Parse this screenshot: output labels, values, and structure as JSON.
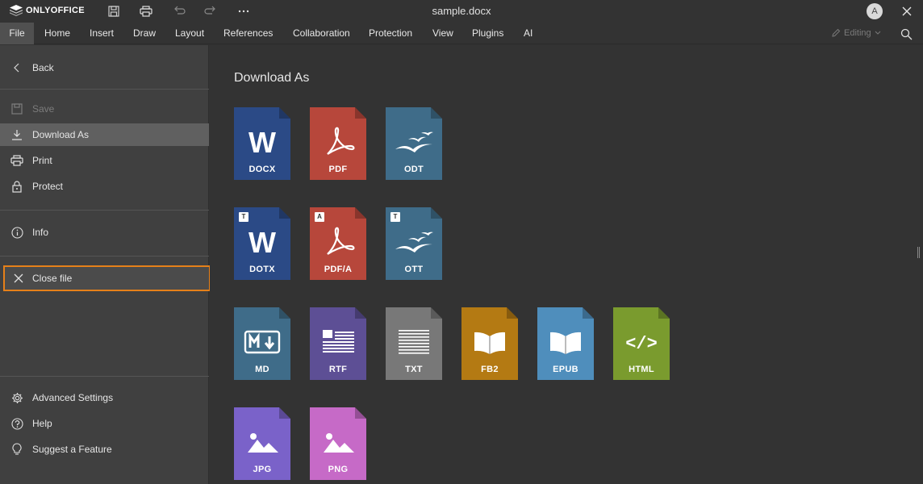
{
  "app": {
    "brand": "ONLYOFFICE",
    "doc_title": "sample.docx",
    "avatar_initial": "A",
    "editing_label": "Editing"
  },
  "menu": {
    "tabs": [
      "File",
      "Home",
      "Insert",
      "Draw",
      "Layout",
      "References",
      "Collaboration",
      "Protection",
      "View",
      "Plugins",
      "AI"
    ],
    "active_tab": "File"
  },
  "file_panel": {
    "back": "Back",
    "save": "Save",
    "download_as": "Download As",
    "print": "Print",
    "protect": "Protect",
    "info": "Info",
    "close_file": "Close file",
    "advanced_settings": "Advanced Settings",
    "help": "Help",
    "suggest_feature": "Suggest a Feature"
  },
  "download": {
    "heading": "Download As",
    "formats": [
      {
        "ext": "DOCX",
        "color": "#2b4a86",
        "glyph": "W",
        "badge": ""
      },
      {
        "ext": "PDF",
        "color": "#b7473b",
        "glyph": "pdf",
        "badge": ""
      },
      {
        "ext": "ODT",
        "color": "#3f6c89",
        "glyph": "gulls",
        "badge": ""
      },
      {
        "ext": "DOTX",
        "color": "#2b4a86",
        "glyph": "W",
        "badge": "T"
      },
      {
        "ext": "PDF/A",
        "color": "#b7473b",
        "glyph": "pdf",
        "badge": "A"
      },
      {
        "ext": "OTT",
        "color": "#3f6c89",
        "glyph": "gulls",
        "badge": "T"
      },
      {
        "ext": "MD",
        "color": "#3f6c89",
        "glyph": "md",
        "badge": ""
      },
      {
        "ext": "RTF",
        "color": "#5d4f95",
        "glyph": "rtf",
        "badge": ""
      },
      {
        "ext": "TXT",
        "color": "#787878",
        "glyph": "txt",
        "badge": ""
      },
      {
        "ext": "FB2",
        "color": "#b47a13",
        "glyph": "book",
        "badge": ""
      },
      {
        "ext": "EPUB",
        "color": "#4f8ebc",
        "glyph": "book",
        "badge": ""
      },
      {
        "ext": "HTML",
        "color": "#7a9b2e",
        "glyph": "html",
        "badge": ""
      },
      {
        "ext": "JPG",
        "color": "#7a62c9",
        "glyph": "image",
        "badge": ""
      },
      {
        "ext": "PNG",
        "color": "#c66ac7",
        "glyph": "image",
        "badge": ""
      }
    ]
  }
}
